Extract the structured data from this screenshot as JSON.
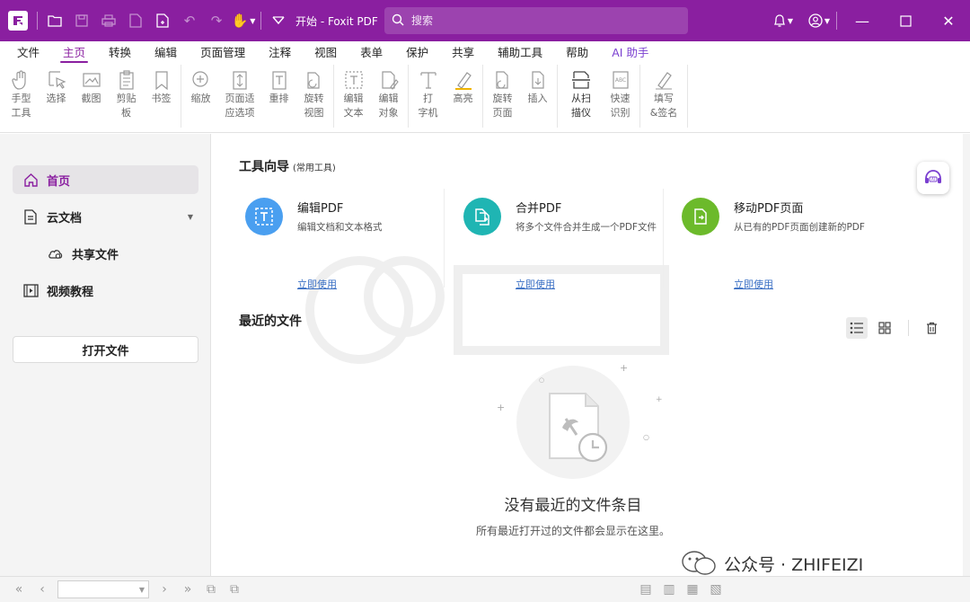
{
  "titlebar": {
    "doc_title": "开始 - Foxit PDF ...",
    "search_placeholder": "搜索",
    "accent_color": "#8a1fa0"
  },
  "menu": {
    "items": [
      "文件",
      "主页",
      "转换",
      "编辑",
      "页面管理",
      "注释",
      "视图",
      "表单",
      "保护",
      "共享",
      "辅助工具",
      "帮助",
      "AI 助手"
    ],
    "active": "主页"
  },
  "ribbon": {
    "buttons": [
      {
        "label": "手型\n工具",
        "icon": "hand-icon"
      },
      {
        "label": "选择",
        "icon": "select-cursor-icon"
      },
      {
        "label": "截图",
        "icon": "screenshot-icon"
      },
      {
        "label": "剪贴\n板",
        "icon": "clipboard-icon"
      },
      {
        "label": "书签",
        "icon": "bookmark-icon"
      },
      {
        "label": "缩放",
        "icon": "zoom-icon"
      },
      {
        "label": "页面适\n应选项",
        "icon": "fit-page-icon"
      },
      {
        "label": "重排",
        "icon": "reflow-icon"
      },
      {
        "label": "旋转\n视图",
        "icon": "rotate-view-icon"
      },
      {
        "label": "编辑\n文本",
        "icon": "edit-text-icon"
      },
      {
        "label": "编辑\n对象",
        "icon": "edit-object-icon"
      },
      {
        "label": "打\n字机",
        "icon": "typewriter-icon"
      },
      {
        "label": "高亮",
        "icon": "highlight-icon"
      },
      {
        "label": "旋转\n页面",
        "icon": "rotate-page-icon"
      },
      {
        "label": "插入",
        "icon": "insert-icon"
      },
      {
        "label": "从扫\n描仪",
        "icon": "scanner-icon"
      },
      {
        "label": "快速\n识别",
        "icon": "ocr-icon"
      },
      {
        "label": "填写\n&签名",
        "icon": "fill-sign-icon"
      }
    ]
  },
  "sidebar": {
    "home": "首页",
    "cloud": "云文档",
    "shared": "共享文件",
    "video": "视频教程",
    "open_file": "打开文件"
  },
  "tools_section": {
    "title": "工具向导",
    "subtitle": "(常用工具)",
    "cards": [
      {
        "name": "编辑PDF",
        "desc": "编辑文档和文本格式",
        "link": "立即使用",
        "color": "#4a9ff0"
      },
      {
        "name": "合并PDF",
        "desc": "将多个文件合并生成一个PDF文件",
        "link": "立即使用",
        "color": "#1fb5b3"
      },
      {
        "name": "移动PDF页面",
        "desc": "从已有的PDF页面创建新的PDF",
        "link": "立即使用",
        "color": "#6cba2b"
      }
    ]
  },
  "recent": {
    "title": "最近的文件",
    "empty_title": "没有最近的文件条目",
    "empty_sub": "所有最近打开过的文件都会显示在这里。"
  },
  "watermark": {
    "text": "公众号 · ZHIFEIZI"
  }
}
